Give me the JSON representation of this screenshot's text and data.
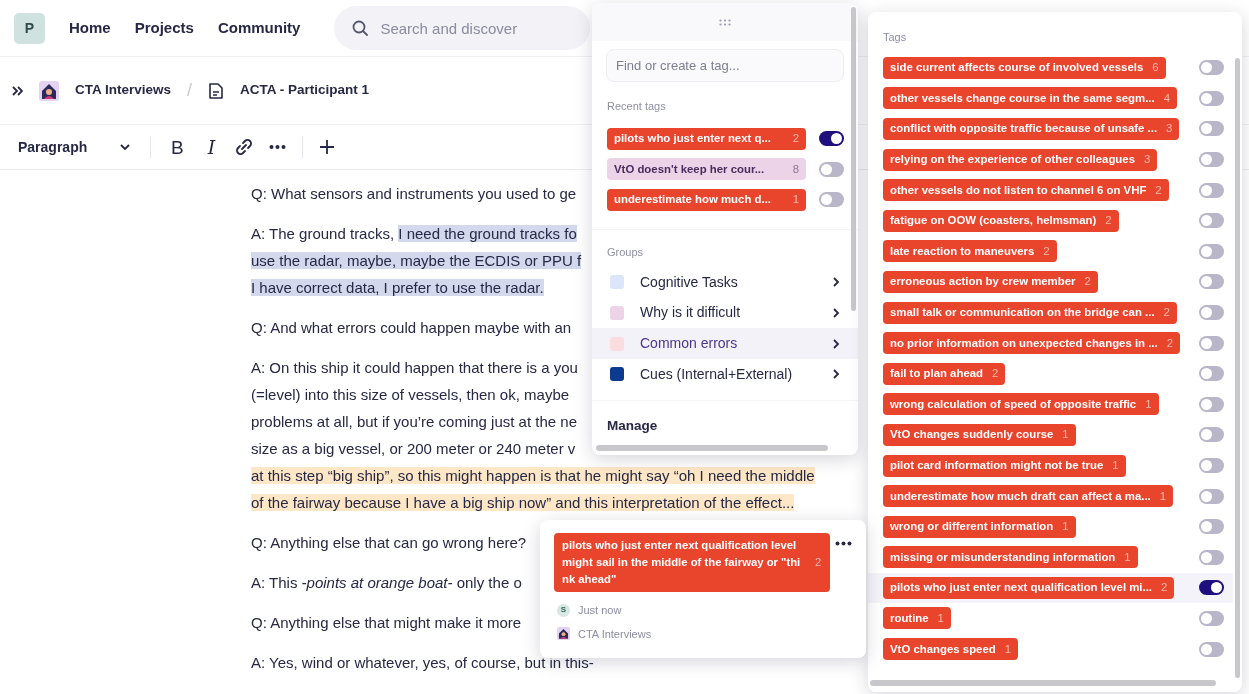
{
  "navbar": {
    "logo": "P",
    "links": [
      "Home",
      "Projects",
      "Community"
    ],
    "search": {
      "placeholder": "Search and discover"
    }
  },
  "breadcrumb": {
    "separator": "/",
    "items": [
      {
        "label": "CTA Interviews",
        "kind": "project"
      },
      {
        "label": "ACTA - Participant 1",
        "kind": "document"
      }
    ]
  },
  "toolbar": {
    "block_style": "Paragraph",
    "format_buttons": [
      {
        "kind": "bold",
        "label": "B"
      },
      {
        "kind": "italic",
        "label": "I"
      }
    ]
  },
  "document": {
    "paragraphs": [
      {
        "lines": [
          [
            {
              "text": "Q: What sensors and instruments you used to ge"
            }
          ]
        ]
      },
      {
        "lines": [
          [
            {
              "text": "A: The ground tracks, "
            },
            {
              "text": "I need the ground tracks fo",
              "kind": "selection"
            }
          ],
          [
            {
              "text": "use the radar, maybe, maybe the ECDIS or PPU f",
              "kind": "selection"
            }
          ],
          [
            {
              "text": "I have correct data, I prefer to use the radar.",
              "kind": "selection"
            }
          ]
        ]
      },
      {
        "lines": [
          [
            {
              "text": "Q: And what errors could happen maybe with an"
            }
          ]
        ]
      },
      {
        "lines": [
          [
            {
              "text": "A: On this ship it could happen that there is a you"
            }
          ],
          [
            {
              "text": "(=level) into this size of vessels, then ok, maybe"
            }
          ],
          [
            {
              "text": "problems at all, but if you’re coming just at the ne"
            }
          ],
          [
            {
              "text": "size as a big vessel, or 200 meter or 240 meter v"
            }
          ],
          [
            {
              "text": "at this step “big ship”, so this might happen is that he might say “oh I need the middle",
              "kind": "tag"
            }
          ],
          [
            {
              "text": "of the fairway because I have a big ship now” and this interpretation of the effect...",
              "kind": "tag"
            }
          ]
        ]
      },
      {
        "lines": [
          [
            {
              "text": "Q: Anything else that can go wrong here?"
            }
          ]
        ]
      },
      {
        "lines": [
          [
            {
              "text": "A: This *-points at orange boat-* only the o"
            }
          ]
        ]
      },
      {
        "lines": [
          [
            {
              "text": "Q: Anything else that might make it more"
            }
          ]
        ]
      },
      {
        "lines": [
          [
            {
              "text": "A: Yes, wind or whatever, yes, of course, but in this-"
            }
          ]
        ]
      }
    ]
  },
  "tag_picker": {
    "search": {
      "placeholder": "Find or create a tag..."
    },
    "recent_label": "Recent tags",
    "recent_tags": [
      {
        "label": "pilots who just enter next q...",
        "count": "2",
        "color": "#e8452c",
        "on": true
      },
      {
        "label": "VtO doesn't keep her cour...",
        "count": "8",
        "color": "#ecd3e8",
        "on": false
      },
      {
        "label": "underestimate how much d...",
        "count": "1",
        "color": "#e8452c",
        "on": false
      }
    ],
    "groups_label": "Groups",
    "groups": [
      {
        "label": "Cognitive Tasks",
        "color": "#dde6f8",
        "selected": false
      },
      {
        "label": "Why is it difficult",
        "color": "#ecd3e8",
        "selected": false
      },
      {
        "label": "Common errors",
        "color": "#fbdde0",
        "selected": true
      },
      {
        "label": "Cues (Internal+External)",
        "color": "#0b3a8f",
        "selected": false
      }
    ],
    "manage": "Manage"
  },
  "tags_panel": {
    "title": "Tags",
    "tags": [
      {
        "label": "side current affects course of involved vessels",
        "count": "6",
        "color": "#e8452c",
        "on": false,
        "selected": false
      },
      {
        "label": "other vessels change course in the same segm...",
        "count": "4",
        "color": "#e8452c",
        "on": false,
        "selected": false
      },
      {
        "label": "conflict with opposite traffic because of unsafe ...",
        "count": "3",
        "color": "#e8452c",
        "on": false,
        "selected": false
      },
      {
        "label": "relying on the experience of other colleagues",
        "count": "3",
        "color": "#e8452c",
        "on": false,
        "selected": false
      },
      {
        "label": "other vessels do not listen to channel 6 on VHF",
        "count": "2",
        "color": "#e8452c",
        "on": false,
        "selected": false
      },
      {
        "label": "fatigue on OOW (coasters, helmsman)",
        "count": "2",
        "color": "#e8452c",
        "on": false,
        "selected": false
      },
      {
        "label": "late reaction to maneuvers",
        "count": "2",
        "color": "#e8452c",
        "on": false,
        "selected": false
      },
      {
        "label": "erroneous action by crew member",
        "count": "2",
        "color": "#e8452c",
        "on": false,
        "selected": false
      },
      {
        "label": "small talk or communication on the bridge can ...",
        "count": "2",
        "color": "#e8452c",
        "on": false,
        "selected": false
      },
      {
        "label": "no prior information on unexpected changes in ...",
        "count": "2",
        "color": "#e8452c",
        "on": false,
        "selected": false
      },
      {
        "label": "fail to plan ahead",
        "count": "2",
        "color": "#e8452c",
        "on": false,
        "selected": false
      },
      {
        "label": "wrong calculation of speed of opposite traffic",
        "count": "1",
        "color": "#e8452c",
        "on": false,
        "selected": false
      },
      {
        "label": "VtO changes suddenly course",
        "count": "1",
        "color": "#e8452c",
        "on": false,
        "selected": false
      },
      {
        "label": "pilot card information might not be true",
        "count": "1",
        "color": "#e8452c",
        "on": false,
        "selected": false
      },
      {
        "label": "underestimate how much draft can affect a ma...",
        "count": "1",
        "color": "#e8452c",
        "on": false,
        "selected": false
      },
      {
        "label": "wrong or different information",
        "count": "1",
        "color": "#e8452c",
        "on": false,
        "selected": false
      },
      {
        "label": "missing or misunderstanding information",
        "count": "1",
        "color": "#e8452c",
        "on": false,
        "selected": false
      },
      {
        "label": "pilots who just enter next qualification level mi...",
        "count": "2",
        "color": "#e8452c",
        "on": true,
        "selected": true
      },
      {
        "label": "routine",
        "count": "1",
        "color": "#e8452c",
        "on": false,
        "selected": false
      },
      {
        "label": "VtO changes speed",
        "count": "1",
        "color": "#e8452c",
        "on": false,
        "selected": false
      }
    ]
  },
  "comment_card": {
    "tag": {
      "label": "pilots who just enter next qualification level might sail in the middle of the fairway or \"think ahead\"",
      "count": "2",
      "color": "#e8452c"
    },
    "author_initial": "S",
    "time": "Just now",
    "project": "CTA Interviews"
  }
}
